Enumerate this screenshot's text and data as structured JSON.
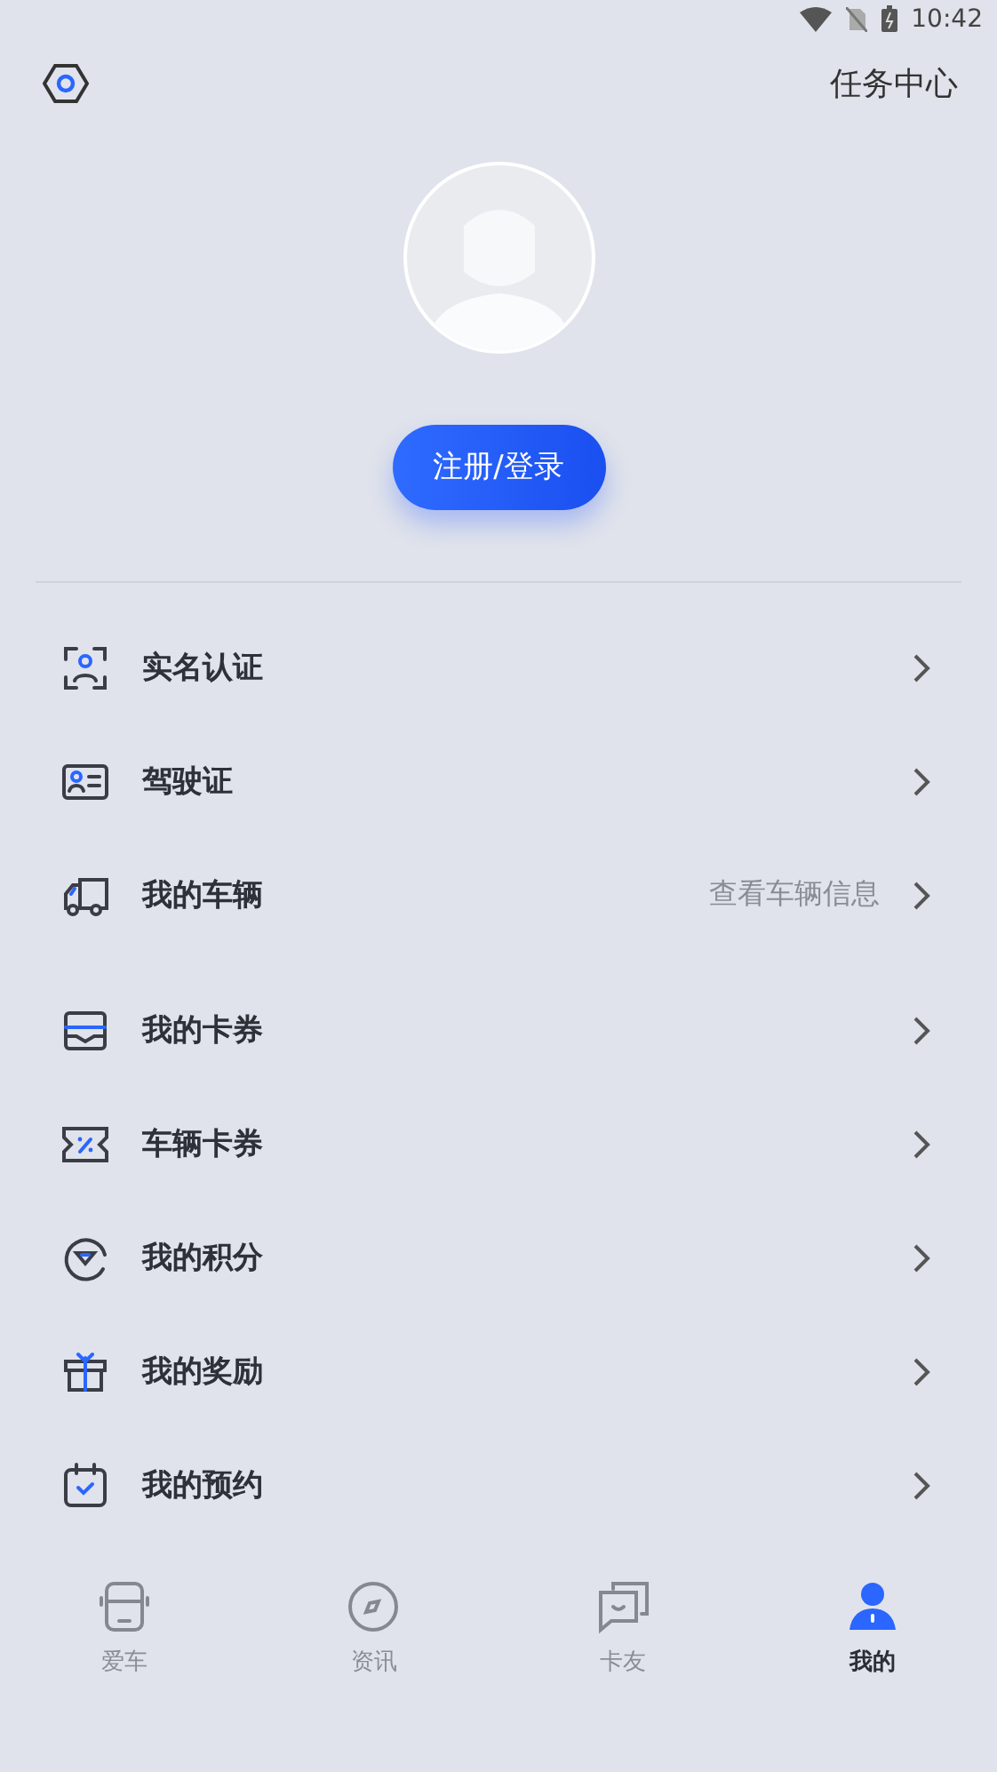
{
  "status_bar": {
    "time": "10:42"
  },
  "header": {
    "task_center": "任务中心"
  },
  "login_button": "注册/登录",
  "menu_groups": [
    [
      {
        "kind": "id-scan",
        "label": "实名认证"
      },
      {
        "kind": "license",
        "label": "驾驶证"
      },
      {
        "kind": "truck",
        "label": "我的车辆",
        "hint": "查看车辆信息"
      }
    ],
    [
      {
        "kind": "card",
        "label": "我的卡券"
      },
      {
        "kind": "coupon",
        "label": "车辆卡券"
      },
      {
        "kind": "points",
        "label": "我的积分"
      },
      {
        "kind": "gift",
        "label": "我的奖励"
      },
      {
        "kind": "calendar",
        "label": "我的预约"
      }
    ]
  ],
  "tabs": [
    {
      "kind": "bus",
      "label": "爱车",
      "selected": false
    },
    {
      "kind": "compass",
      "label": "资讯",
      "selected": false
    },
    {
      "kind": "chat",
      "label": "卡友",
      "selected": false
    },
    {
      "kind": "person",
      "label": "我的",
      "selected": true
    }
  ]
}
